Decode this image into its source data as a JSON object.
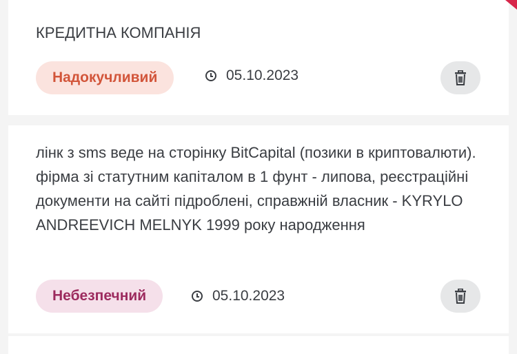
{
  "reviews": [
    {
      "text": "КРЕДИТНА КОМПАНІЯ",
      "badge": "Надокучливий",
      "date": "05.10.2023",
      "badge_color": "#d2553a",
      "badge_bg": "#fbe3de",
      "icons": {
        "date": "clock-icon",
        "delete": "trash-icon"
      }
    },
    {
      "text": "лінк з sms веде на сторінку BitCapital (позики в криптовалюти). фірма зі статутним капіталом в 1 фунт - липова, реєстраційні документи на сайті підроблені, справжній власник - KYRYLO ANDREEVICH MELNYK 1999 року народження",
      "badge": "Небезпечний",
      "date": "05.10.2023",
      "badge_color": "#9c2a5e",
      "badge_bg": "#f5e0ea",
      "icons": {
        "date": "clock-icon",
        "delete": "trash-icon"
      }
    }
  ],
  "accent_color": "#d7264a"
}
